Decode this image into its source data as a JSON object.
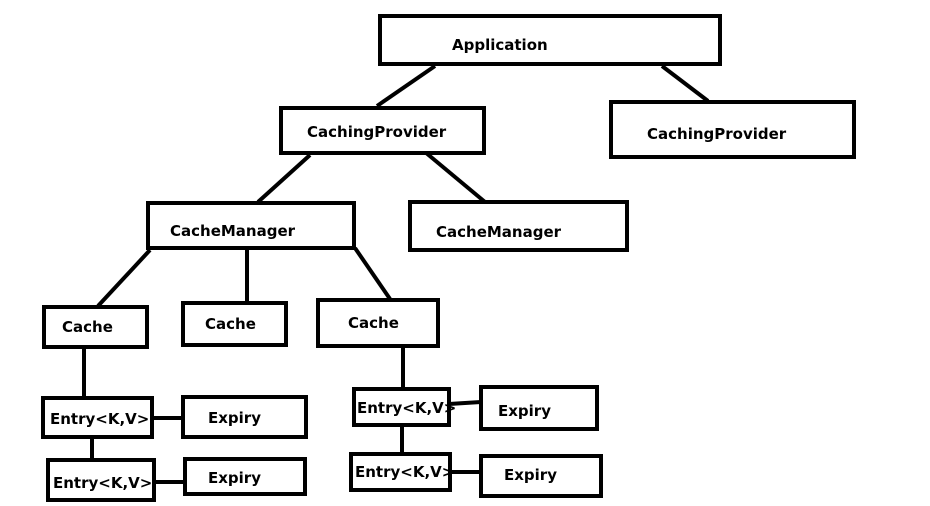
{
  "nodes": {
    "application": "Application",
    "caching_provider_1": "CachingProvider",
    "caching_provider_2": "CachingProvider",
    "cache_manager_1": "CacheManager",
    "cache_manager_2": "CacheManager",
    "cache_1": "Cache",
    "cache_2": "Cache",
    "cache_3": "Cache",
    "entry_1": "Entry<K,V>",
    "expiry_1": "Expiry",
    "entry_2": "Entry<K,V>",
    "expiry_2": "Expiry",
    "entry_3": "Entry<K,V>",
    "expiry_3": "Expiry",
    "entry_4": "Entry<K,V>",
    "expiry_4": "Expiry"
  },
  "edges": [
    [
      "application",
      "caching_provider_1"
    ],
    [
      "application",
      "caching_provider_2"
    ],
    [
      "caching_provider_1",
      "cache_manager_1"
    ],
    [
      "caching_provider_1",
      "cache_manager_2"
    ],
    [
      "cache_manager_1",
      "cache_1"
    ],
    [
      "cache_manager_1",
      "cache_2"
    ],
    [
      "cache_manager_1",
      "cache_3"
    ],
    [
      "cache_1",
      "entry_1"
    ],
    [
      "entry_1",
      "expiry_1"
    ],
    [
      "entry_1",
      "entry_2"
    ],
    [
      "entry_2",
      "expiry_2"
    ],
    [
      "cache_3",
      "entry_3"
    ],
    [
      "entry_3",
      "expiry_3"
    ],
    [
      "entry_3",
      "entry_4"
    ],
    [
      "entry_4",
      "expiry_4"
    ]
  ]
}
